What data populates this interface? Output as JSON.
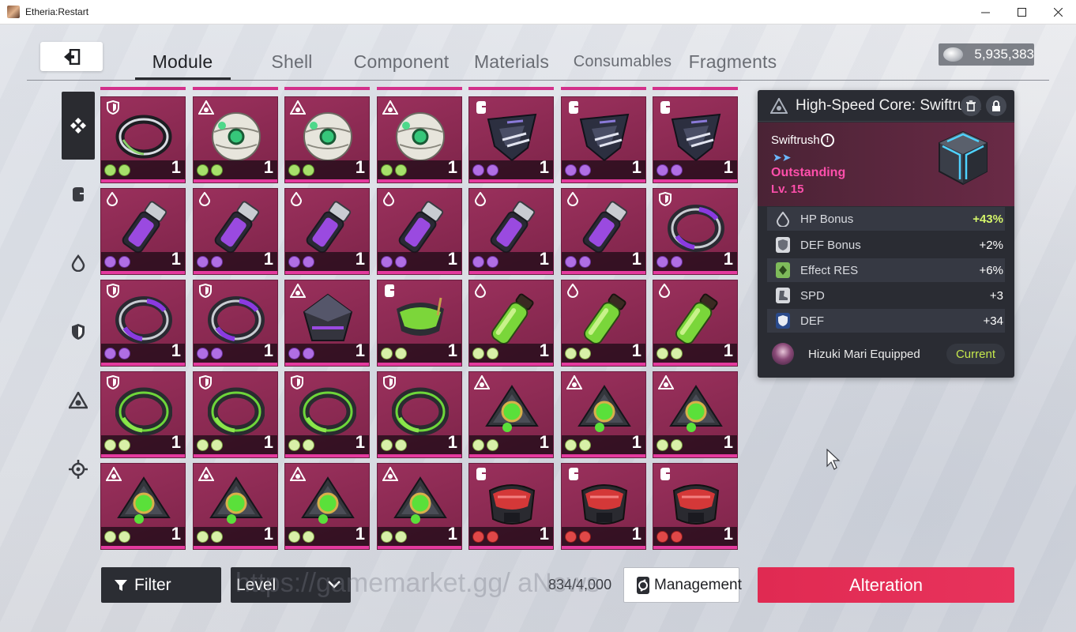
{
  "window": {
    "title": "Etheria:Restart"
  },
  "nav": {
    "tabs": [
      {
        "label": "Module",
        "active": true
      },
      {
        "label": "Shell"
      },
      {
        "label": "Component"
      },
      {
        "label": "Materials"
      },
      {
        "label": "Consumables"
      },
      {
        "label": "Fragments"
      }
    ],
    "currency": "5,935,383"
  },
  "rail": [
    "all-icon",
    "fist-icon",
    "drop-icon",
    "shield-icon",
    "core-icon",
    "target-icon"
  ],
  "grid": {
    "rows": [
      [
        {
          "slot": "shield",
          "item": "ring-black",
          "set": "green",
          "qty": "1"
        },
        {
          "slot": "core",
          "item": "orb-white",
          "set": "green",
          "qty": "1"
        },
        {
          "slot": "core",
          "item": "orb-white",
          "set": "green",
          "qty": "1"
        },
        {
          "slot": "core",
          "item": "orb-white",
          "set": "green",
          "qty": "1"
        },
        {
          "slot": "fist",
          "item": "shard-dark",
          "set": "purple",
          "qty": "1"
        },
        {
          "slot": "fist",
          "item": "shard-dark",
          "set": "purple",
          "qty": "1"
        },
        {
          "slot": "fist",
          "item": "shard-dark",
          "set": "purple",
          "qty": "1"
        }
      ],
      [
        {
          "slot": "drop",
          "item": "vial-purple",
          "set": "purple",
          "qty": "1"
        },
        {
          "slot": "drop",
          "item": "vial-purple",
          "set": "purple",
          "qty": "1"
        },
        {
          "slot": "drop",
          "item": "vial-purple",
          "set": "purple",
          "qty": "1"
        },
        {
          "slot": "drop",
          "item": "vial-purple",
          "set": "purple",
          "qty": "1"
        },
        {
          "slot": "drop",
          "item": "vial-purple",
          "set": "purple",
          "qty": "1"
        },
        {
          "slot": "drop",
          "item": "vial-purple",
          "set": "purple",
          "qty": "1"
        },
        {
          "slot": "shield",
          "item": "ring-purple",
          "set": "purple",
          "qty": "1"
        }
      ],
      [
        {
          "slot": "shield",
          "item": "ring-purple",
          "set": "purple",
          "qty": "1"
        },
        {
          "slot": "shield",
          "item": "ring-purple",
          "set": "purple",
          "qty": "1"
        },
        {
          "slot": "core",
          "item": "prism-purple",
          "set": "purple",
          "qty": "1"
        },
        {
          "slot": "fist",
          "item": "visor-green",
          "set": "lime",
          "qty": "1"
        },
        {
          "slot": "drop",
          "item": "vial-green",
          "set": "lime",
          "qty": "1"
        },
        {
          "slot": "drop",
          "item": "vial-green",
          "set": "lime",
          "qty": "1"
        },
        {
          "slot": "drop",
          "item": "vial-green",
          "set": "lime",
          "qty": "1"
        }
      ],
      [
        {
          "slot": "shield",
          "item": "ring-green",
          "set": "lime",
          "qty": "1"
        },
        {
          "slot": "shield",
          "item": "ring-green",
          "set": "lime",
          "qty": "1"
        },
        {
          "slot": "shield",
          "item": "ring-green",
          "set": "lime",
          "qty": "1"
        },
        {
          "slot": "shield",
          "item": "ring-green",
          "set": "lime",
          "qty": "1"
        },
        {
          "slot": "core",
          "item": "tri-green",
          "set": "lime",
          "qty": "1"
        },
        {
          "slot": "core",
          "item": "tri-green",
          "set": "lime",
          "qty": "1"
        },
        {
          "slot": "core",
          "item": "tri-green",
          "set": "lime",
          "qty": "1"
        }
      ],
      [
        {
          "slot": "core",
          "item": "tri-green",
          "set": "lime",
          "qty": "1"
        },
        {
          "slot": "core",
          "item": "tri-green",
          "set": "lime",
          "qty": "1"
        },
        {
          "slot": "core",
          "item": "tri-green",
          "set": "lime",
          "qty": "1"
        },
        {
          "slot": "core",
          "item": "tri-green",
          "set": "lime",
          "qty": "1"
        },
        {
          "slot": "fist",
          "item": "mask-red",
          "set": "red",
          "qty": "1"
        },
        {
          "slot": "fist",
          "item": "mask-red",
          "set": "red",
          "qty": "1"
        },
        {
          "slot": "fist",
          "item": "mask-red",
          "set": "red",
          "qty": "1"
        }
      ]
    ]
  },
  "detail": {
    "title": "High-Speed Core: Swiftrush",
    "name": "Swiftrush",
    "arrows": "➤➤",
    "grade": "Outstanding",
    "level": "Lv. 15",
    "main_stat": {
      "label": "HP Bonus",
      "value": "+43%"
    },
    "sub_stats": [
      {
        "label": "DEF Bonus",
        "value": "+2%",
        "icon": "shield-icon"
      },
      {
        "label": "Effect RES",
        "value": "+6%",
        "icon": "resist-icon"
      },
      {
        "label": "SPD",
        "value": "+3",
        "icon": "boot-icon"
      },
      {
        "label": "DEF",
        "value": "+34",
        "icon": "def-icon"
      }
    ],
    "equipped_by": "Hizuki Mari  Equipped",
    "current_label": "Current"
  },
  "bottom": {
    "filter_label": "Filter",
    "level_label": "Level",
    "capacity": "834/4,000",
    "management_label": "Management",
    "alteration_label": "Alteration",
    "watermark": "https://gamemarket.gg/         aNews"
  },
  "colors": {
    "cell": "#8a2a52",
    "cell_bar": "#e43a9e",
    "alter": "#e02a52",
    "grade": "#ff4fab",
    "highlight": "#d4f56a"
  }
}
